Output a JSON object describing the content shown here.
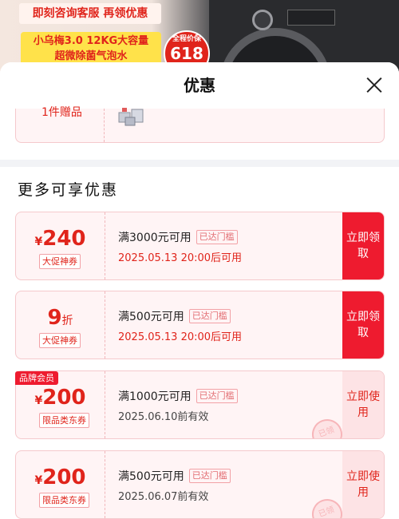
{
  "banner": {
    "headline": "即刻咨询客服 再领优惠",
    "product_line1": "小乌梅3.0 12KG大容量",
    "product_line2": "超微除菌气泡水",
    "seal_top": "全程价保",
    "seal_main": "618"
  },
  "sheet": {
    "title": "优惠",
    "partial_label": "1件赠品",
    "section_title": "更多可享优惠"
  },
  "coupons": [
    {
      "currency": "¥",
      "amount": "240",
      "unit": "",
      "tag": "大促神券",
      "condition": "满3000元可用",
      "status": "已达门槛",
      "time": "2025.05.13 20:00后可用",
      "action": "立即领取"
    },
    {
      "currency": "",
      "amount": "9",
      "unit": "折",
      "tag": "大促神券",
      "condition": "满500元可用",
      "status": "已达门槛",
      "time": "2025.05.13 20:00后可用",
      "action": "立即领取"
    },
    {
      "badge": "品牌会员",
      "currency": "¥",
      "amount": "200",
      "unit": "",
      "tag": "限品类东券",
      "condition": "满1000元可用",
      "status": "已达门槛",
      "time": "2025.06.10前有效",
      "action": "立即使用",
      "stamp": "已领"
    },
    {
      "currency": "¥",
      "amount": "200",
      "unit": "",
      "tag": "限品类东券",
      "condition": "满500元可用",
      "status": "已达门槛",
      "time": "2025.06.07前有效",
      "action": "立即使用",
      "stamp": "已领"
    }
  ],
  "colors": {
    "accent": "#ee1b2f",
    "card_bg": "#fff4f5"
  }
}
